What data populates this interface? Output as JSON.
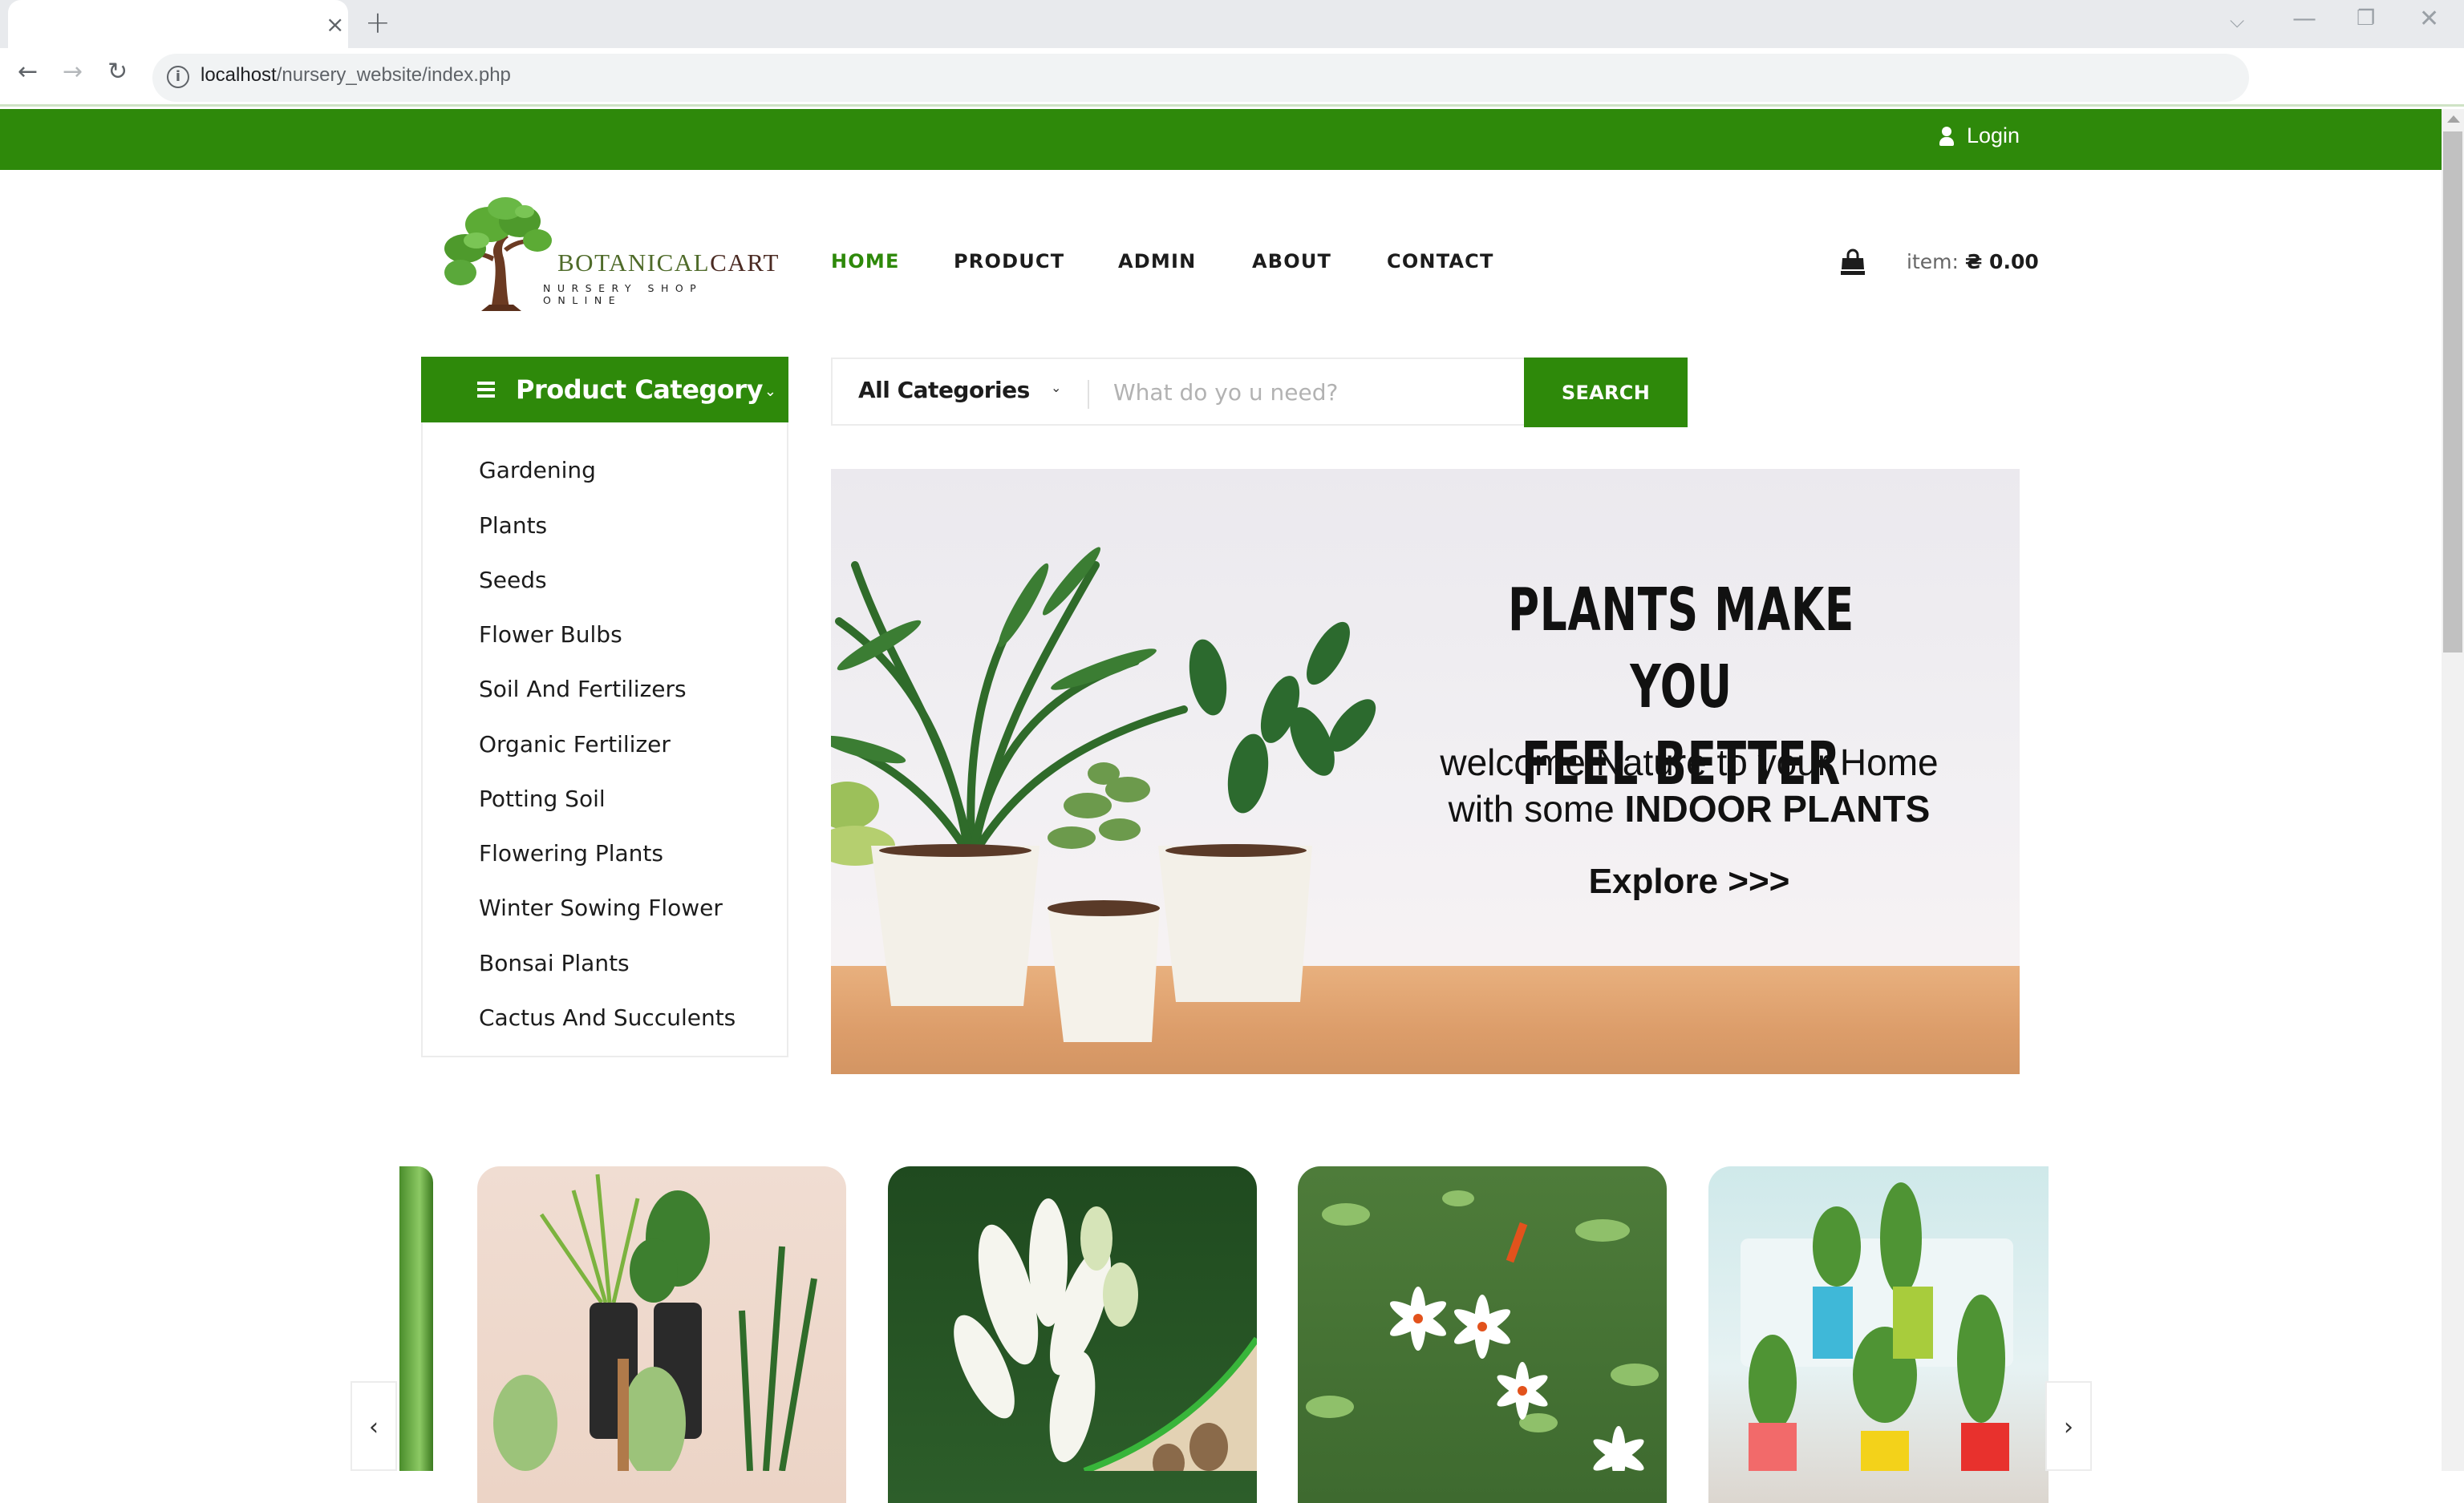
{
  "browser": {
    "tab_close": "×",
    "new_tab": "+",
    "url_host": "localhost",
    "url_path": "/nursery_website/index.php",
    "window_controls": {
      "dropdown": "⌵",
      "minimize": "—",
      "restore": "❐",
      "close": "✕"
    },
    "nav": {
      "back": "←",
      "forward": "→",
      "reload": "↻"
    },
    "info_icon": "i"
  },
  "topbar": {
    "login_label": "Login",
    "login_icon": "user-icon"
  },
  "header": {
    "logo": {
      "brand_part1": "BOTANICAL",
      "brand_part2": "CART",
      "tagline": "NURSERY SHOP ONLINE",
      "brand_color_1": "#4f6b2a",
      "brand_color_2": "#4a2a22"
    },
    "nav": [
      {
        "label": "HOME",
        "active": true
      },
      {
        "label": "PRODUCT",
        "active": false
      },
      {
        "label": "ADMIN",
        "active": false
      },
      {
        "label": "ABOUT",
        "active": false
      },
      {
        "label": "CONTACT",
        "active": false
      }
    ],
    "cart": {
      "icon": "shopping-bag-icon",
      "label": "item:",
      "amount": "₴ 0.00"
    }
  },
  "category_panel": {
    "title": "Product Category",
    "chevron": "⌄",
    "items": [
      "Gardening",
      "Plants",
      "Seeds",
      "Flower Bulbs",
      "Soil And Fertilizers",
      "Organic Fertilizer",
      "Potting Soil",
      "Flowering Plants",
      "Winter Sowing Flower",
      "Bonsai Plants",
      "Cactus And Succulents"
    ]
  },
  "search": {
    "category_selected": "All Categories",
    "chevron": "⌄",
    "placeholder": "What do yo u need?",
    "value": "",
    "button_label": "SEARCH"
  },
  "hero": {
    "title_line1": "PLANTS MAKE YOU",
    "title_line2": "FEEL BETTER",
    "sub_line1": "welcome Nature to your Home",
    "sub_line2_prefix": "with some ",
    "sub_line2_bold": "INDOOR PLANTS",
    "cta": "Explore >>>"
  },
  "carousel": {
    "prev": "‹",
    "next": "›",
    "cards": [
      {
        "name": "indoor-plants-on-stands"
      },
      {
        "name": "tuberose-bulbs"
      },
      {
        "name": "night-jasmine-flowers"
      },
      {
        "name": "colorful-potted-plants"
      }
    ]
  },
  "colors": {
    "brand_green": "#2e890a",
    "text_dark": "#1c1c1c",
    "placeholder": "#b2b2b2"
  }
}
